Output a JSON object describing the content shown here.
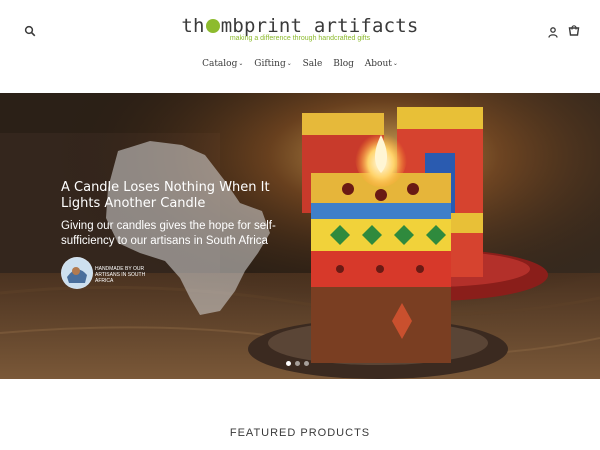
{
  "header": {
    "logo_title_pre": "th",
    "logo_title_post": "mbprint artifacts",
    "logo_tagline": "making a difference through handcrafted gifts",
    "search_icon": "search-icon",
    "account_icon": "user-icon",
    "cart_icon": "cart-icon"
  },
  "nav": {
    "items": [
      {
        "label": "Catalog",
        "has_dropdown": true
      },
      {
        "label": "Gifting",
        "has_dropdown": true
      },
      {
        "label": "Sale",
        "has_dropdown": false
      },
      {
        "label": "Blog",
        "has_dropdown": false
      },
      {
        "label": "About",
        "has_dropdown": true
      }
    ]
  },
  "hero": {
    "headline": "A Candle Loses Nothing When It Lights Another Candle",
    "subheading": "Giving our candles gives the hope for self-sufficiency to our artisans in South Africa",
    "badge_text": "HANDMADE BY OUR ARTISANS IN SOUTH AFRICA",
    "slides": 3,
    "active_slide": 1
  },
  "featured": {
    "title": "FEATURED PRODUCTS"
  },
  "colors": {
    "brand_green": "#8dbb2e",
    "text": "#3a3a3a"
  }
}
